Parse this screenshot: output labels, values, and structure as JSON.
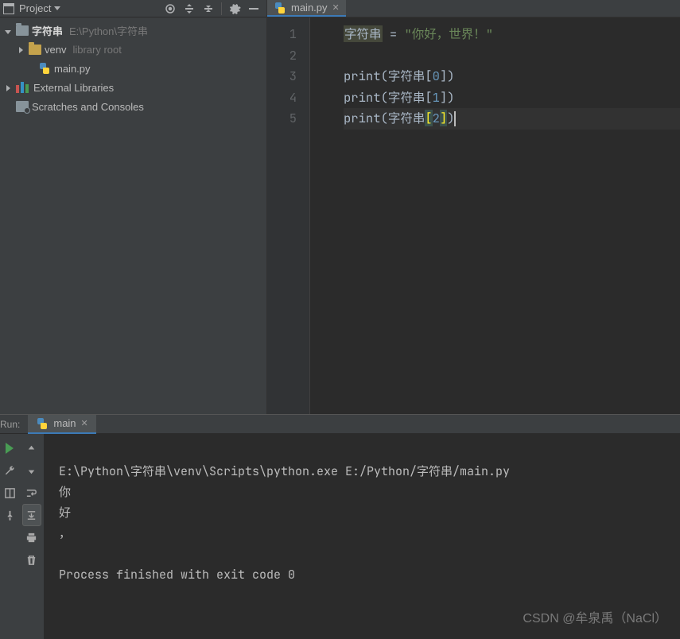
{
  "sidebar": {
    "title": "Project",
    "items": [
      {
        "label": "字符串",
        "path": "E:\\Python\\字符串",
        "type": "root"
      },
      {
        "label": "venv",
        "note": "library root",
        "type": "libfolder"
      },
      {
        "label": "main.py",
        "type": "pyfile"
      },
      {
        "label": "External Libraries",
        "type": "extlibs"
      },
      {
        "label": "Scratches and Consoles",
        "type": "scratches"
      }
    ]
  },
  "editor": {
    "tab_label": "main.py",
    "line_numbers": [
      "1",
      "2",
      "3",
      "4",
      "5"
    ],
    "code": {
      "var": "字符串",
      "assign": "=",
      "str_literal": "\"你好，世界！\"",
      "call": "print",
      "idx0": "0",
      "idx1": "1",
      "idx2": "2"
    }
  },
  "run": {
    "label": "Run:",
    "tab_label": "main",
    "output_lines": [
      "E:\\Python\\字符串\\venv\\Scripts\\python.exe E:/Python/字符串/main.py",
      "你",
      "好",
      "，",
      "",
      "Process finished with exit code 0"
    ]
  },
  "watermark": "CSDN @牟泉禹（NaCl）"
}
